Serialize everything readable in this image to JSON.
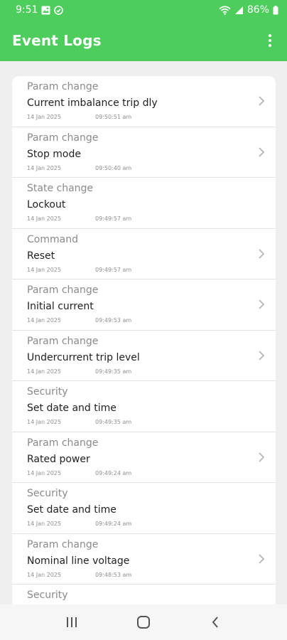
{
  "status": {
    "time": "9:51",
    "battery": "86%"
  },
  "header": {
    "title": "Event Logs",
    "menu_icon": "more-vert-icon"
  },
  "events": [
    {
      "category": "Param change",
      "title": "Current imbalance trip dly",
      "date": "14 Jan 2025",
      "time": "09:50:51 am",
      "chevron": true
    },
    {
      "category": "Param change",
      "title": "Stop mode",
      "date": "14 Jan 2025",
      "time": "09:50:40 am",
      "chevron": true
    },
    {
      "category": "State change",
      "title": "Lockout",
      "date": "14 Jan 2025",
      "time": "09:49:57 am",
      "chevron": false
    },
    {
      "category": "Command",
      "title": "Reset",
      "date": "14 Jan 2025",
      "time": "09:49:57 am",
      "chevron": true
    },
    {
      "category": "Param change",
      "title": "Initial current",
      "date": "14 Jan 2025",
      "time": "09:49:53 am",
      "chevron": true
    },
    {
      "category": "Param change",
      "title": "Undercurrent trip level",
      "date": "14 Jan 2025",
      "time": "09:49:35 am",
      "chevron": true
    },
    {
      "category": "Security",
      "title": "Set date and time",
      "date": "14 Jan 2025",
      "time": "09:49:35 am",
      "chevron": false
    },
    {
      "category": "Param change",
      "title": "Rated power",
      "date": "14 Jan 2025",
      "time": "09:49:24 am",
      "chevron": true
    },
    {
      "category": "Security",
      "title": "Set date and time",
      "date": "14 Jan 2025",
      "time": "09:49:24 am",
      "chevron": false
    },
    {
      "category": "Param change",
      "title": "Nominal line voltage",
      "date": "14 Jan 2025",
      "time": "09:48:53 am",
      "chevron": true
    },
    {
      "category": "Security",
      "title": "",
      "date": "",
      "time": "",
      "chevron": false
    }
  ],
  "navigation": {
    "recents_icon": "recents-icon",
    "home_icon": "home-icon",
    "back_icon": "back-icon"
  },
  "colors": {
    "brand_green": "#4ccd5c",
    "background": "#efefef",
    "card": "#ffffff"
  }
}
